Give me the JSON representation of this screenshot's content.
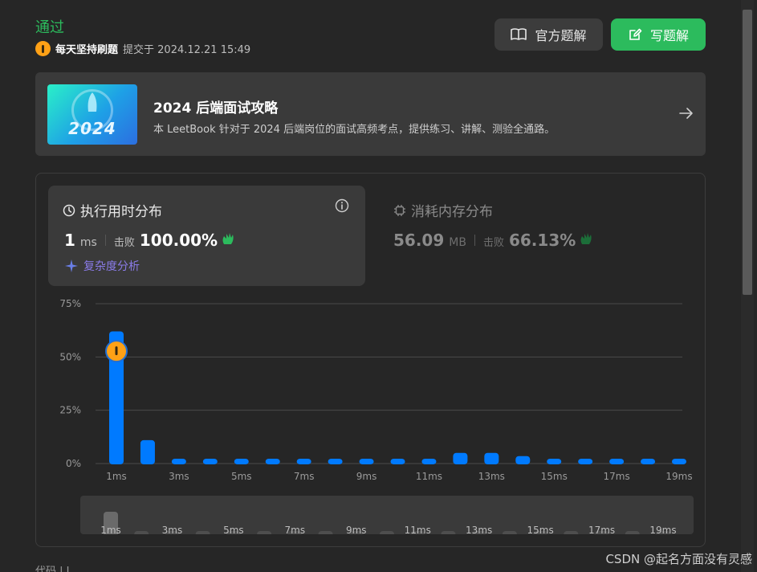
{
  "submission": {
    "status": "通过",
    "username": "每天坚持刷题",
    "submitted_at": "提交于 2024.12.21 15:49"
  },
  "actions": {
    "official_solution": "官方题解",
    "write_solution": "写题解"
  },
  "banner": {
    "thumb_year": "2024",
    "title": "2024 后端面试攻略",
    "description": "本 LeetBook 针对于 2024 后端岗位的面试高频考点，提供练习、讲解、测验全通路。"
  },
  "runtime": {
    "heading": "执行用时分布",
    "value": "1",
    "unit": "ms",
    "beats_label": "击败",
    "beats": "100.00%",
    "complexity_link": "复杂度分析"
  },
  "memory": {
    "heading": "消耗内存分布",
    "value": "56.09",
    "unit": "MB",
    "beats_label": "击败",
    "beats": "66.13%"
  },
  "colors": {
    "accent_green": "#2cbb5d",
    "bar_blue": "#007aff",
    "marker_orange": "#ffa116"
  },
  "chart_data": {
    "type": "bar",
    "x": [
      "1ms",
      "2ms",
      "3ms",
      "4ms",
      "5ms",
      "6ms",
      "7ms",
      "8ms",
      "9ms",
      "10ms",
      "11ms",
      "12ms",
      "13ms",
      "14ms",
      "15ms",
      "16ms",
      "17ms",
      "18ms",
      "19ms"
    ],
    "tick_labels": [
      "1ms",
      "3ms",
      "5ms",
      "7ms",
      "9ms",
      "11ms",
      "13ms",
      "15ms",
      "17ms",
      "19ms"
    ],
    "values": [
      62,
      11,
      2,
      2,
      2,
      2,
      2,
      2,
      2,
      2,
      2,
      5,
      5,
      3.5,
      2,
      2,
      2,
      2,
      2
    ],
    "yticks": [
      "75%",
      "50%",
      "25%",
      "0%"
    ],
    "ylim": [
      0,
      75
    ],
    "highlight_index": 0,
    "grid": true,
    "overview_ticks": [
      "1ms",
      "3ms",
      "5ms",
      "7ms",
      "9ms",
      "11ms",
      "13ms",
      "15ms",
      "17ms",
      "19ms"
    ]
  },
  "watermark": "CSDN @起名方面没有灵感",
  "peek": "代码 | J"
}
